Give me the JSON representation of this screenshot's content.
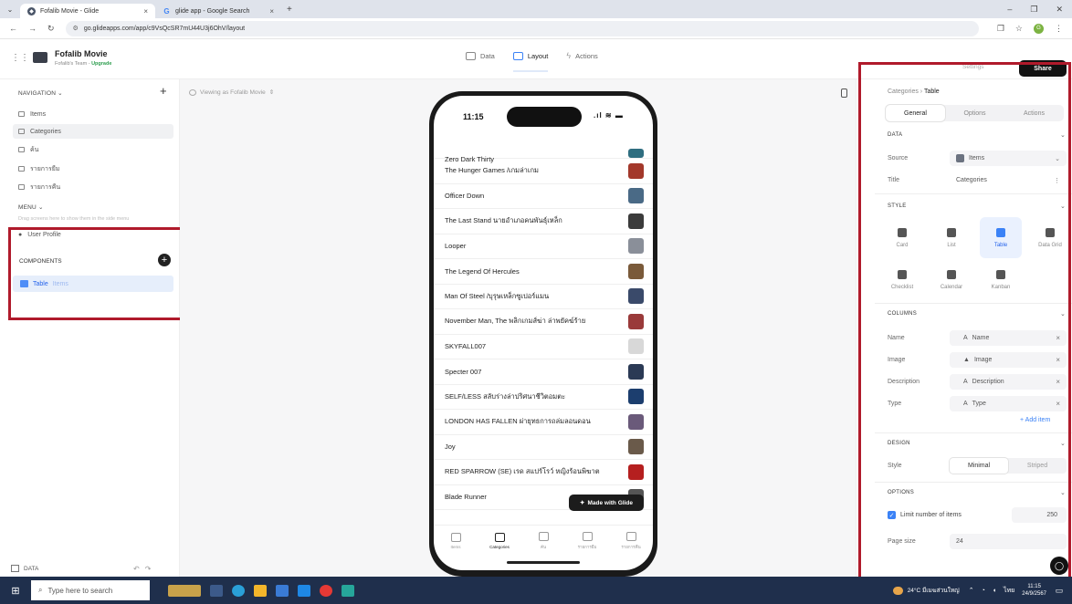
{
  "browser": {
    "tabs": [
      {
        "title": "Fofalib Movie - Glide",
        "active": true
      },
      {
        "title": "glide app - Google Search",
        "active": false
      }
    ],
    "url": "go.glideapps.com/app/c9VsQcSR7mU44U3j6OhV/layout"
  },
  "header": {
    "app_name": "Fofalib Movie",
    "team": "Fofalib's Team -",
    "upgrade": "Upgrade",
    "modes": [
      "Data",
      "Layout",
      "Actions"
    ],
    "active_mode": "Layout"
  },
  "left_panel": {
    "navigation_title": "NAVIGATION",
    "nav_items": [
      "Items",
      "Categories",
      "ค้น",
      "รายการยืม",
      "รายการคืน"
    ],
    "menu_title": "MENU",
    "drag_hint": "Drag screens here to show them in the side menu",
    "menu_items": [
      "User Profile"
    ],
    "components_title": "COMPONENTS",
    "component": {
      "name": "Table",
      "source": "Items"
    },
    "footer_label": "DATA"
  },
  "canvas": {
    "viewing_as": "Viewing as Fofalib Movie"
  },
  "phone": {
    "time": "11:15",
    "clipped_title": "Zero Dark Thirty",
    "movies": [
      "The Hunger Games /เกมล่าเกม",
      "Officer Down",
      "The Last Stand นายอำเภอคนพันธุ์เหล็ก",
      "Looper",
      "The Legend Of Hercules",
      "Man Of Steel /บุรุษเหล็กซูเปอร์แมน",
      "November Man, The พลิกเกมส์ฆ่า ล่าพยัคฆ์ร้าย",
      "SKYFALL007",
      "Specter 007",
      "SELF/LESS สลับร่างล่าปริศนาชีวิตอมตะ",
      "LONDON HAS FALLEN ผ่ายุทธการถล่มลอนดอน",
      "Joy",
      "RED SPARROW (SE) เรด สแปร์โรว์ หญิงร้อนพิฆาต",
      "Blade Runner"
    ],
    "thumb_colors": [
      "#2f6e80",
      "#a3382b",
      "#4a6a86",
      "#3b3b3b",
      "#8a8f99",
      "#7a5a3a",
      "#3a4a6a",
      "#9a3a3a",
      "#d8d8d8",
      "#2b3a55",
      "#1c3e6e",
      "#6a5a7a",
      "#6a5a4a",
      "#b51f1f",
      "#555555"
    ],
    "made_with": "Made with Glide",
    "bottom_nav": [
      "Items",
      "Categories",
      "ค้น",
      "รายการยืม",
      "รายการคืน"
    ],
    "bottom_nav_active": 1
  },
  "right_panel": {
    "settings_label": "Settings",
    "share_label": "Share",
    "breadcrumb_parent": "Categories",
    "breadcrumb_current": "Table",
    "tabs": [
      "General",
      "Options",
      "Actions"
    ],
    "active_tab": "General",
    "data_title": "DATA",
    "source_label": "Source",
    "source_value": "Items",
    "title_label": "Title",
    "title_value": "Categories",
    "style_title": "STYLE",
    "styles": [
      "Card",
      "List",
      "Table",
      "Data Grid",
      "Checklist",
      "Calendar",
      "Kanban"
    ],
    "active_style": "Table",
    "columns_title": "COLUMNS",
    "columns": [
      {
        "label": "Name",
        "value": "Name",
        "icon": "A"
      },
      {
        "label": "Image",
        "value": "Image",
        "icon": "image-icon"
      },
      {
        "label": "Description",
        "value": "Description",
        "icon": "A"
      },
      {
        "label": "Type",
        "value": "Type",
        "icon": "A"
      }
    ],
    "add_item": "+ Add item",
    "design_title": "DESIGN",
    "design_style_label": "Style",
    "design_options": [
      "Minimal",
      "Striped"
    ],
    "design_active": "Minimal",
    "options_title": "OPTIONS",
    "limit_label": "Limit number of items",
    "limit_checked": true,
    "limit_value": "250",
    "page_size_label": "Page size",
    "page_size_value": "24"
  },
  "taskbar": {
    "search_placeholder": "Type here to search",
    "weather": "24°C มีเมฆส่วนใหญ่",
    "lang": "ไทย",
    "time": "11:15",
    "date": "24/9/2567"
  },
  "colors": {
    "highlight": "#b01a2b",
    "accent": "#3b82f6",
    "taskbar": "#1f2f4c"
  }
}
